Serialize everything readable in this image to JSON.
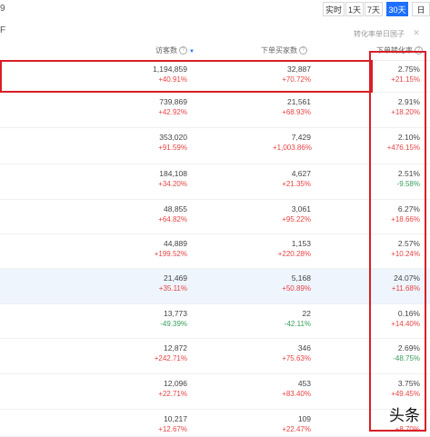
{
  "header": {
    "date_stub": "9"
  },
  "time_buttons": [
    {
      "label": "实时",
      "active": false
    },
    {
      "label": "1天",
      "active": false
    },
    {
      "label": "7天",
      "active": false
    },
    {
      "label": "30天",
      "active": true
    },
    {
      "label": "日",
      "active": false
    }
  ],
  "toolbar": {
    "left_stub": "F",
    "filter_text": "转化率单日国子"
  },
  "columns": {
    "visitors": "访客数",
    "buyers": "下单买家数",
    "conversion": "下单转化率"
  },
  "rows": [
    {
      "visitors": "1,194,859",
      "visitors_chg": "+40.91%",
      "buyers": "32,887",
      "buyers_chg": "+70.72%",
      "conv": "2.75%",
      "conv_chg": "+21.15%"
    },
    {
      "visitors": "739,869",
      "visitors_chg": "+42.92%",
      "buyers": "21,561",
      "buyers_chg": "+68.93%",
      "conv": "2.91%",
      "conv_chg": "+18.20%"
    },
    {
      "visitors": "353,020",
      "visitors_chg": "+91.59%",
      "buyers": "7,429",
      "buyers_chg": "+1,003.86%",
      "conv": "2.10%",
      "conv_chg": "+476.15%"
    },
    {
      "visitors": "184,108",
      "visitors_chg": "+34.20%",
      "buyers": "4,627",
      "buyers_chg": "+21.35%",
      "conv": "2.51%",
      "conv_chg": "-9.58%"
    },
    {
      "visitors": "48,855",
      "visitors_chg": "+64.82%",
      "buyers": "3,061",
      "buyers_chg": "+95.22%",
      "conv": "6.27%",
      "conv_chg": "+18.66%"
    },
    {
      "visitors": "44,889",
      "visitors_chg": "+199.52%",
      "buyers": "1,153",
      "buyers_chg": "+220.28%",
      "conv": "2.57%",
      "conv_chg": "+10.24%"
    },
    {
      "visitors": "21,469",
      "visitors_chg": "+35.11%",
      "buyers": "5,168",
      "buyers_chg": "+50.89%",
      "conv": "24.07%",
      "conv_chg": "+11.68%"
    },
    {
      "visitors": "13,773",
      "visitors_chg": "-49.39%",
      "buyers": "22",
      "buyers_chg": "-42.11%",
      "conv": "0.16%",
      "conv_chg": "+14.40%"
    },
    {
      "visitors": "12,872",
      "visitors_chg": "+242.71%",
      "buyers": "346",
      "buyers_chg": "+75.63%",
      "conv": "2.69%",
      "conv_chg": "-48.75%"
    },
    {
      "visitors": "12,096",
      "visitors_chg": "+22.71%",
      "buyers": "453",
      "buyers_chg": "+83.40%",
      "conv": "3.75%",
      "conv_chg": "+49.45%"
    },
    {
      "visitors": "10,217",
      "visitors_chg": "+12.67%",
      "buyers": "109",
      "buyers_chg": "+22.47%",
      "conv": "",
      "conv_chg": "+8.70%"
    }
  ],
  "watermark": "头条",
  "colors": {
    "accent": "#1e6fff",
    "increase": "#e64545",
    "decrease": "#3a9e5c",
    "highlight_box": "#d81f26",
    "highlight_row": "#eef5fd"
  }
}
